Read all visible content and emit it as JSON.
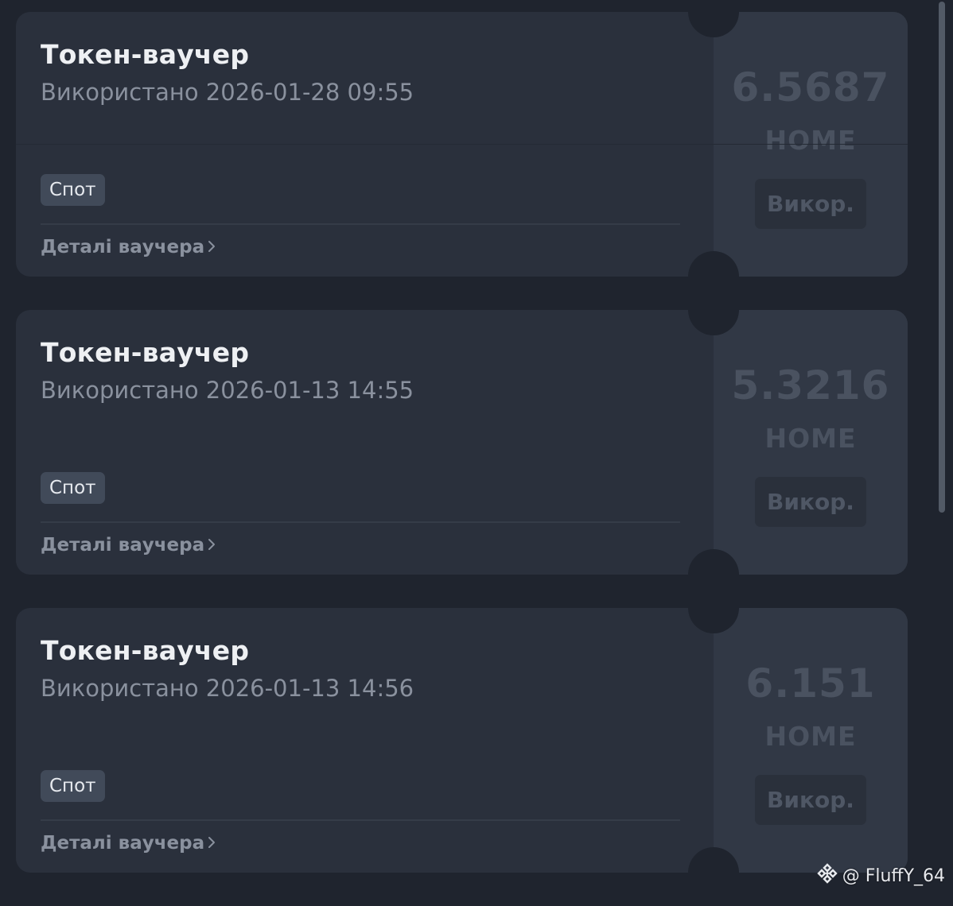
{
  "vouchers": [
    {
      "title": "Токен-ваучер",
      "used_text": "Використано 2026-01-28 09:55",
      "tag": "Спот",
      "details_link": "Деталі ваучера",
      "amount": "6.5687",
      "unit": "HOME",
      "action_label": "Викор."
    },
    {
      "title": "Токен-ваучер",
      "used_text": "Використано 2026-01-13 14:55",
      "tag": "Спот",
      "details_link": "Деталі ваучера",
      "amount": "5.3216",
      "unit": "HOME",
      "action_label": "Викор."
    },
    {
      "title": "Токен-ваучер",
      "used_text": "Використано 2026-01-13 14:56",
      "tag": "Спот",
      "details_link": "Деталі ваучера",
      "amount": "6.151",
      "unit": "HOME",
      "action_label": "Викор."
    }
  ],
  "watermark": {
    "text": "@ FluffY_64",
    "icon": "binance-logo-icon"
  },
  "colors": {
    "background": "#1f242e",
    "card": "#2a303c",
    "card_right": "#313845",
    "tag_bg": "#414a59",
    "muted_text": "#8a919e"
  }
}
